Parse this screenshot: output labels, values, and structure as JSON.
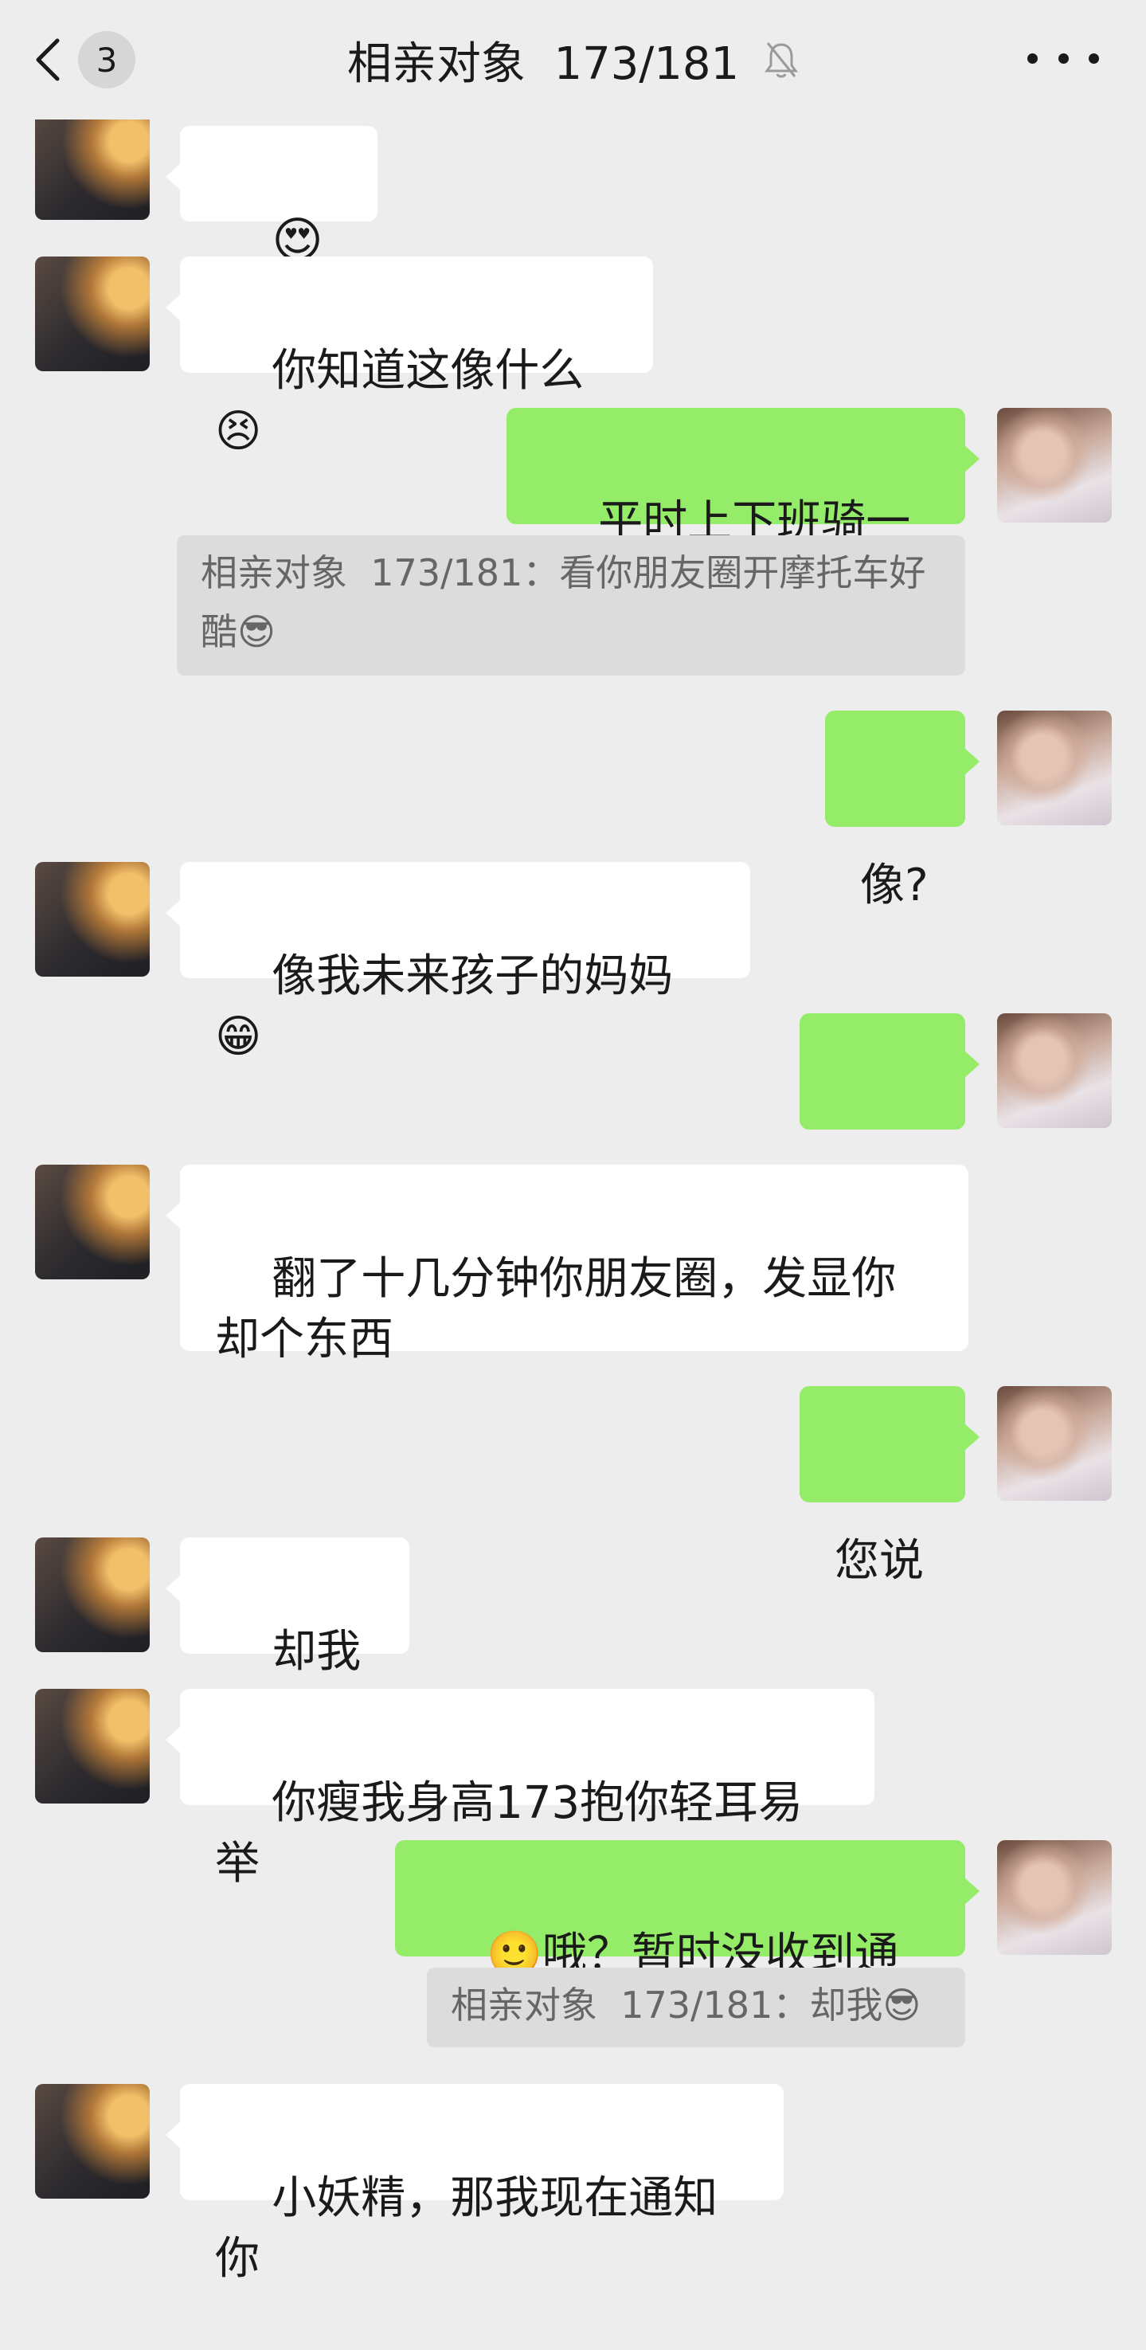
{
  "header": {
    "back_badge": "3",
    "title": "相亲对象  173/181"
  },
  "messages": [
    {
      "id": "m1",
      "sender": "other",
      "text": "😍😍"
    },
    {
      "id": "m2",
      "sender": "other",
      "text": "你知道这像什么😣"
    },
    {
      "id": "m3",
      "sender": "me",
      "text": "平时上下班骑一下"
    },
    {
      "id": "q1",
      "type": "quote",
      "text": "相亲对象  173/181：看你朋友圈开摩托车好酷😎"
    },
    {
      "id": "m4",
      "sender": "me",
      "text": "像?"
    },
    {
      "id": "m5",
      "sender": "other",
      "text": "像我未来孩子的妈妈😁"
    },
    {
      "id": "m6",
      "sender": "me",
      "text": "……"
    },
    {
      "id": "m7",
      "sender": "other",
      "text": "翻了十几分钟你朋友圈，发显你却个东西"
    },
    {
      "id": "m8",
      "sender": "me",
      "text": "您说"
    },
    {
      "id": "m9",
      "sender": "other",
      "text": "却我😎"
    },
    {
      "id": "m10",
      "sender": "other",
      "text": "你瘦我身高173抱你轻耳易举"
    },
    {
      "id": "m11",
      "sender": "me",
      "text": "🙂哦？暂时没收到通知"
    },
    {
      "id": "q2",
      "type": "quote",
      "text": "相亲对象  173/181：却我😎"
    },
    {
      "id": "m12",
      "sender": "other",
      "text": "小妖精，那我现在通知你"
    }
  ],
  "colors": {
    "background": "#ededed",
    "incoming_bubble": "#ffffff",
    "outgoing_bubble": "#95ec69",
    "quote_block": "#dcdcdc"
  },
  "icons": {
    "back": "chevron-left-icon",
    "mute": "bell-off-icon",
    "more": "more-dots-icon"
  }
}
